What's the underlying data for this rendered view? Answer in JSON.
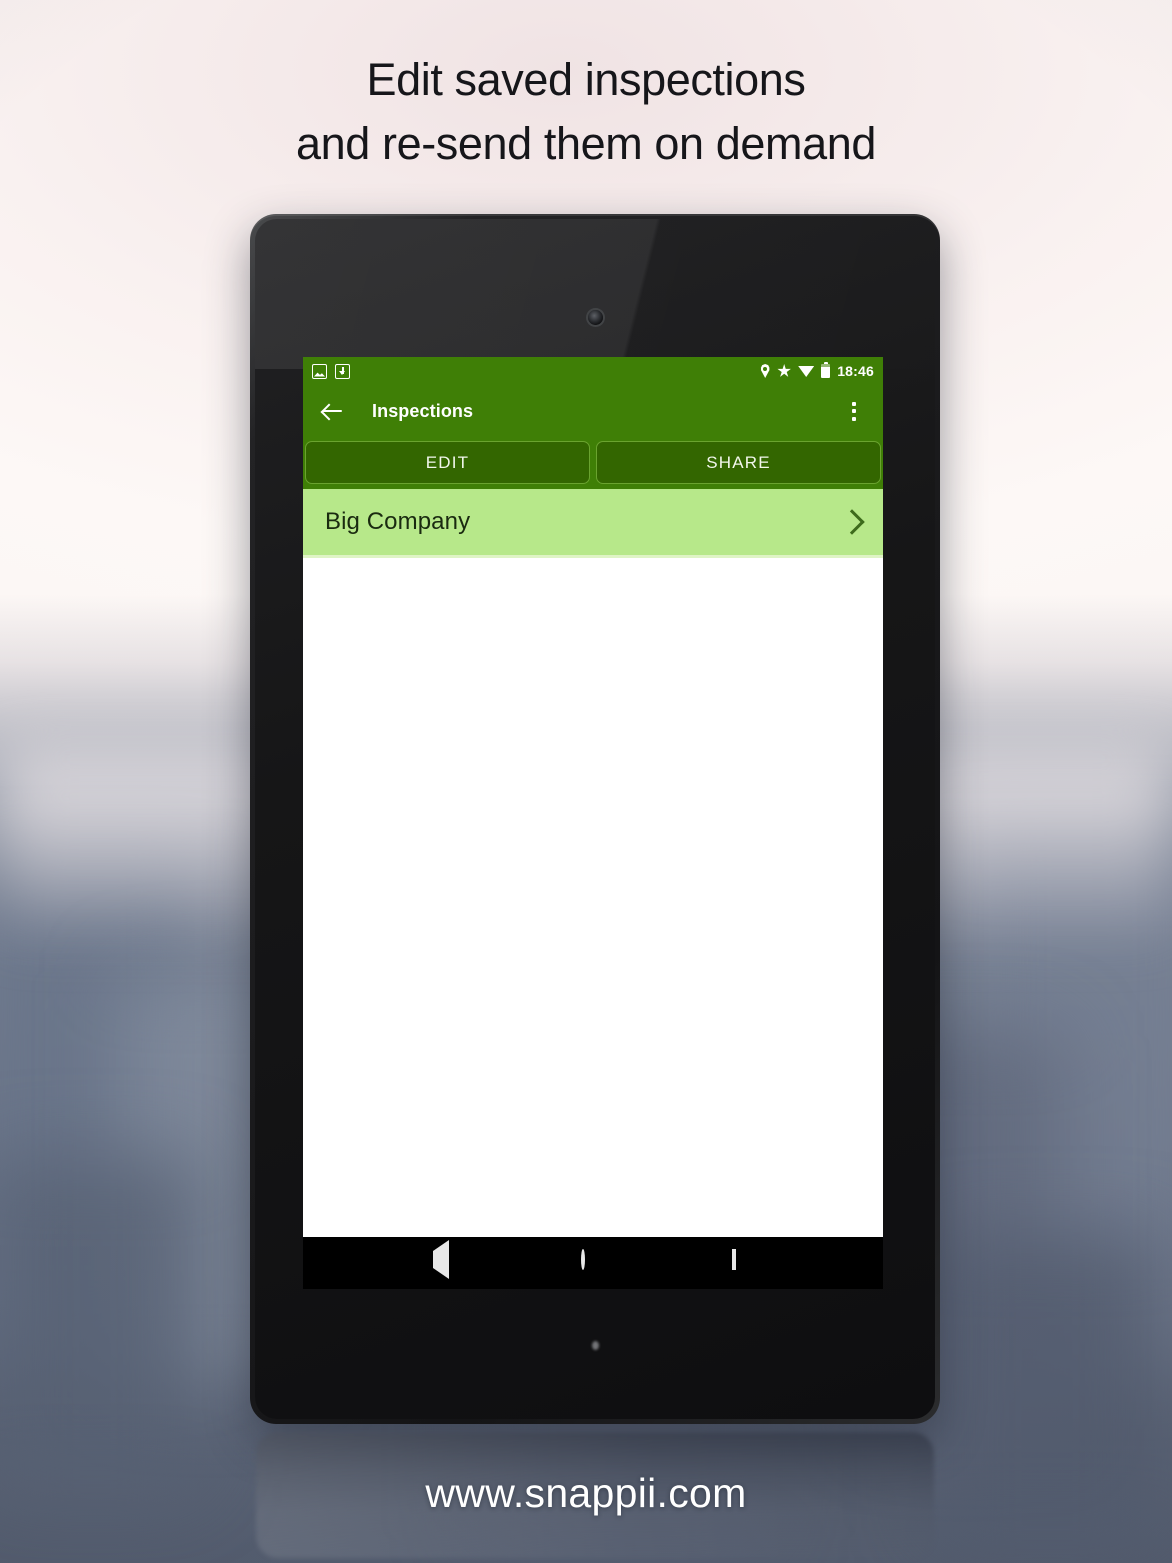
{
  "headline": {
    "line1": "Edit saved inspections",
    "line2": "and re-send them on demand"
  },
  "device": {
    "screen": {
      "status_bar": {
        "icons_left": [
          "image-icon",
          "download-icon"
        ],
        "icons_right": [
          "location-pin-icon",
          "star-icon",
          "wifi-icon",
          "battery-icon"
        ],
        "clock": "18:46"
      },
      "app_bar": {
        "back_icon": "back-arrow-icon",
        "title": "Inspections",
        "overflow_icon": "overflow-menu-icon"
      },
      "actions": [
        {
          "label": "EDIT"
        },
        {
          "label": "SHARE"
        }
      ],
      "list": [
        {
          "label": "Big Company",
          "chevron": "chevron-right-icon"
        }
      ],
      "nav_bar": {
        "back": "nav-back-icon",
        "home": "nav-home-icon",
        "recents": "nav-recents-icon"
      }
    }
  },
  "footer": {
    "url": "www.snappii.com"
  },
  "colors": {
    "app_bar_green": "#3f7f06",
    "button_green": "#336600",
    "button_border_green": "#6aa32f",
    "row_green": "#b7e88a",
    "row_divider_green": "#dff4c5",
    "content_white": "#ffffff",
    "nav_black": "#000000",
    "headline_text": "#16161a",
    "footer_text": "#ffffff"
  }
}
